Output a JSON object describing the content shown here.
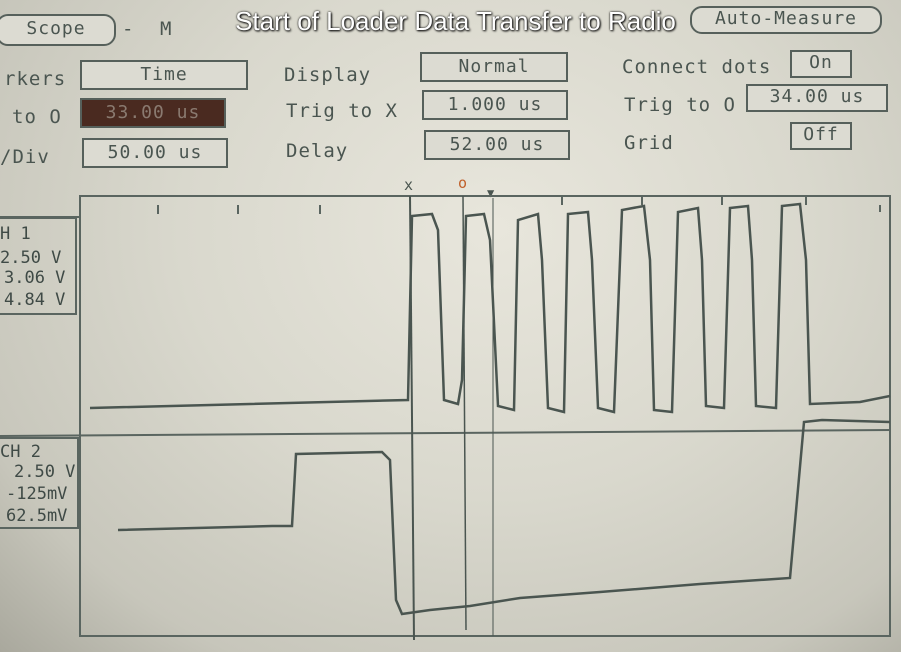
{
  "caption": "Start of Loader Data Transfer to Radio",
  "toolbar": {
    "scope_label": "Scope",
    "dash": "-",
    "partial": "M",
    "auto_measure": "Auto-Measure"
  },
  "settings": {
    "markers_label": "rkers",
    "markers_value": "Time",
    "x_to_o_label": "to O",
    "x_to_o_value": "33.00 us",
    "time_div_label": "/Div",
    "time_div_value": "50.00 us",
    "display_label": "Display",
    "display_value": "Normal",
    "trig_to_x_label": "Trig to X",
    "trig_to_x_value": "1.000 us",
    "delay_label": "Delay",
    "delay_value": "52.00 us",
    "connect_dots_label": "Connect dots",
    "connect_dots_value": "On",
    "trig_to_o_label": "Trig to O",
    "trig_to_o_value": "34.00 us",
    "grid_label": "Grid",
    "grid_value": "Off"
  },
  "markers": {
    "x": "x",
    "o": "o",
    "trigger": "▼"
  },
  "channel1": {
    "name": "H 1",
    "scale": "2.50 V",
    "offset": "3.06 V",
    "marker": "4.84 V"
  },
  "channel2": {
    "name": "CH 2",
    "scale": "2.50 V",
    "offset": "-125mV",
    "marker": "62.5mV"
  },
  "colors": {
    "trace": "#4a5550",
    "background": "#dcdbd2",
    "caption": "#ffffff"
  }
}
